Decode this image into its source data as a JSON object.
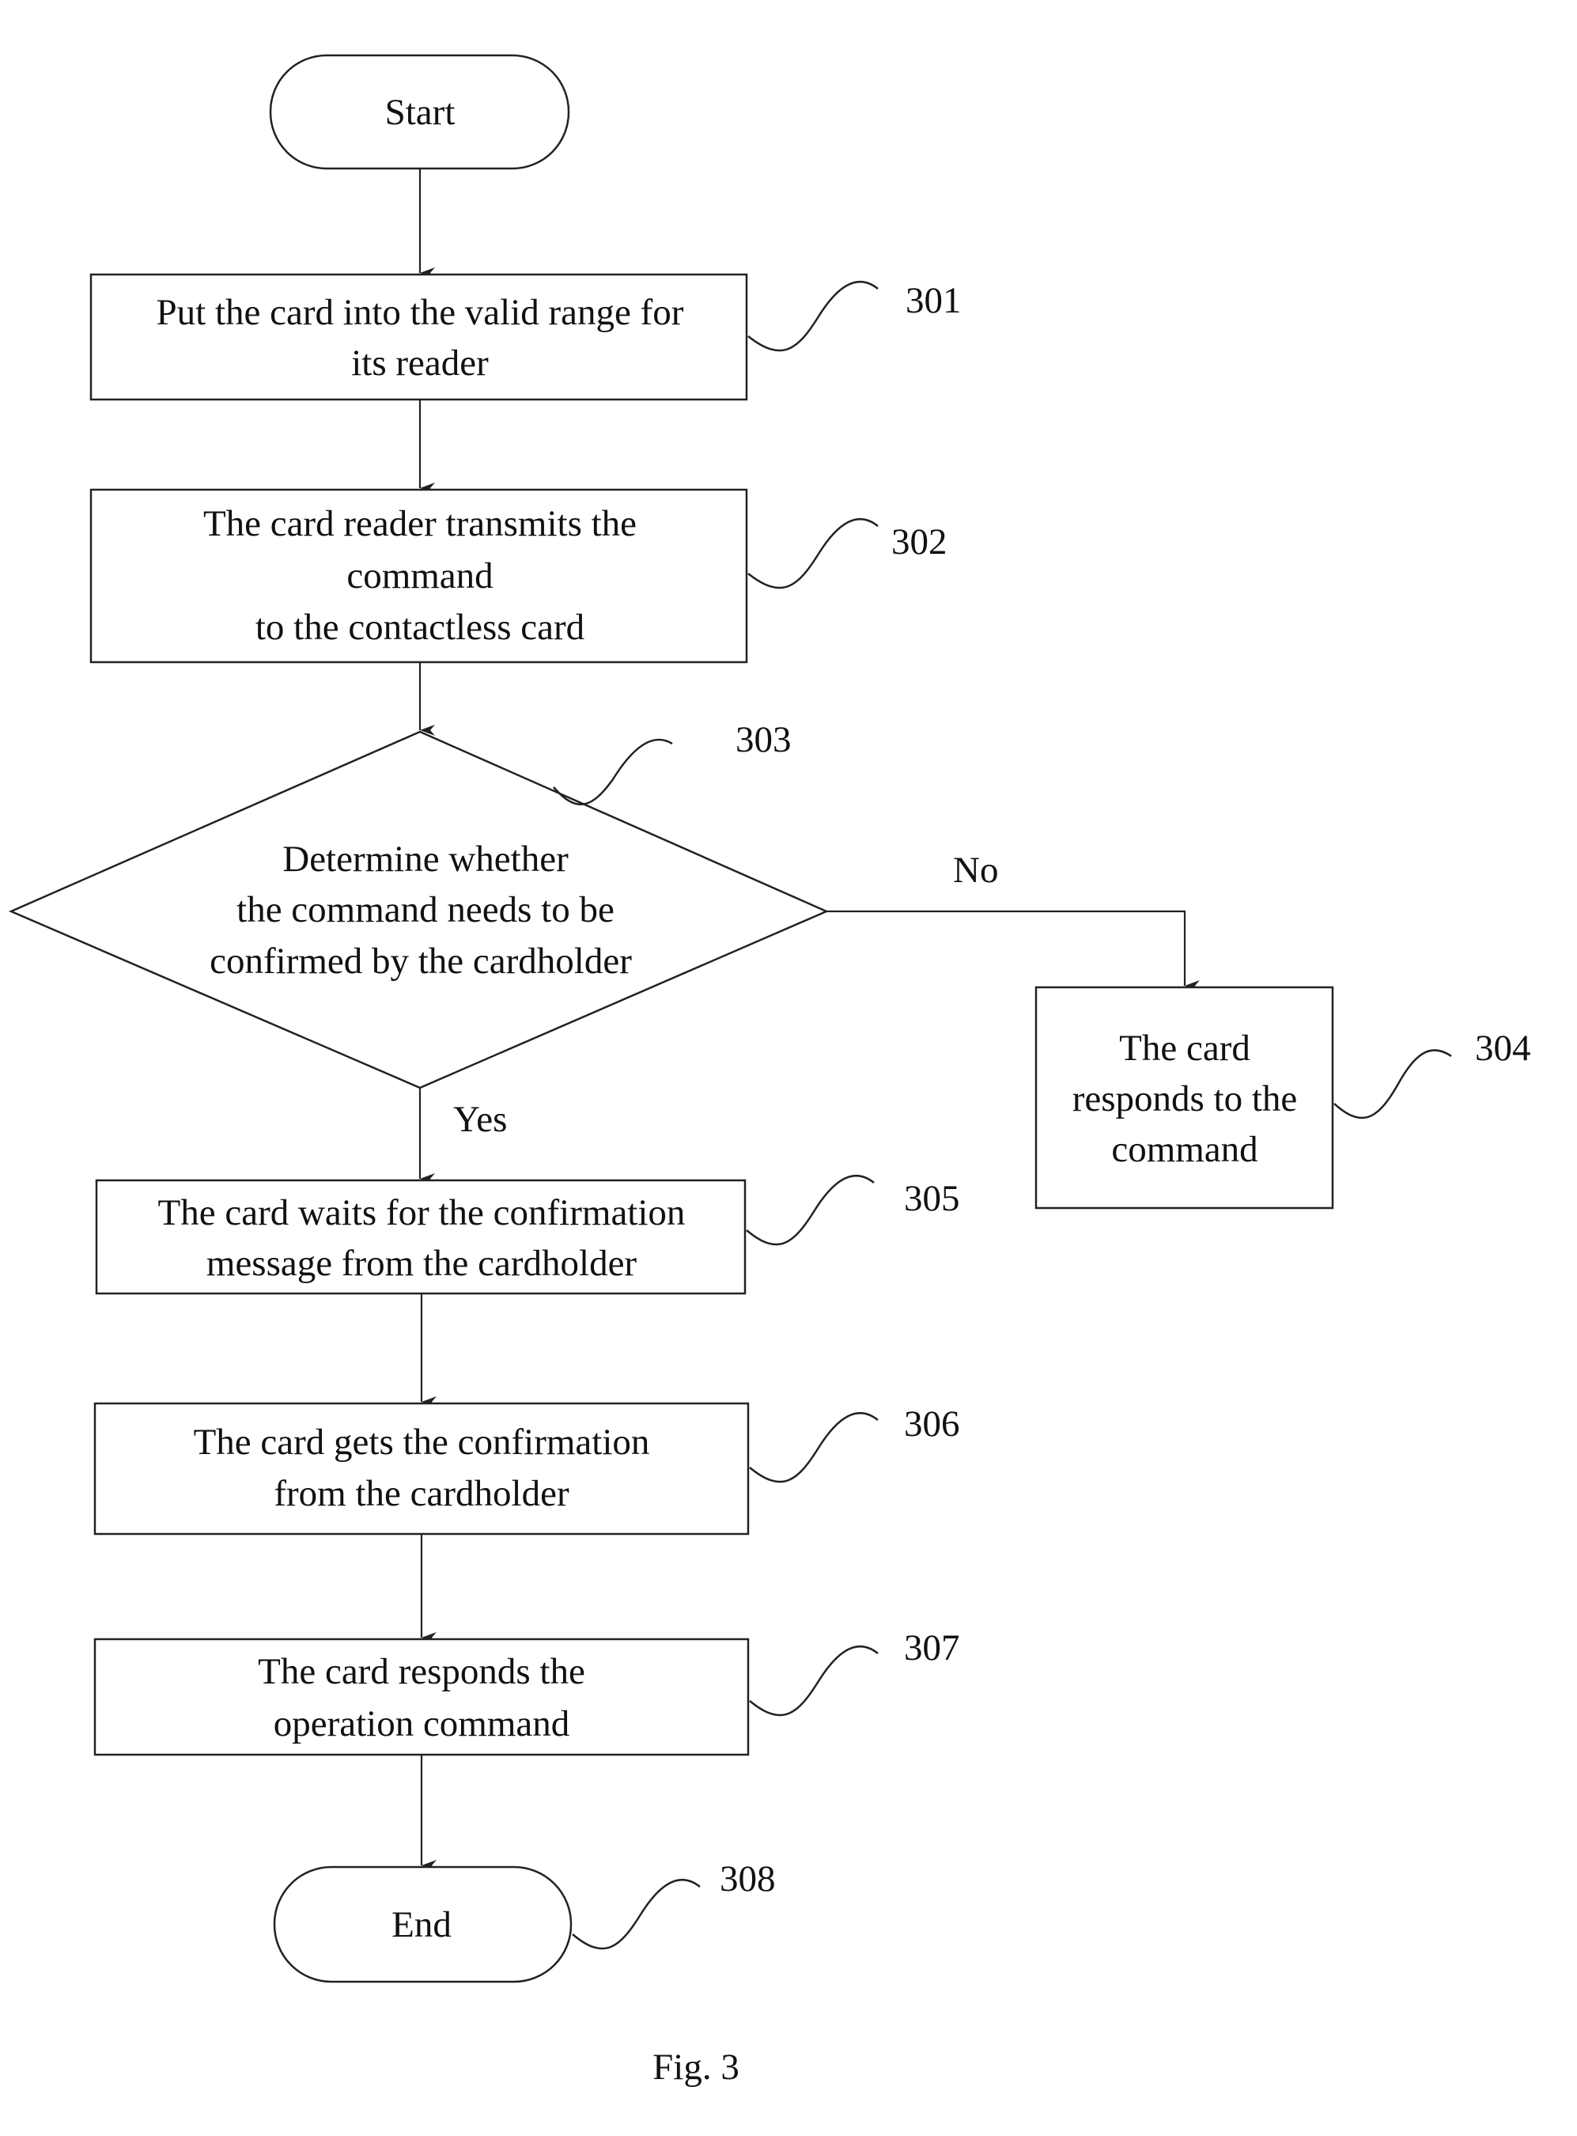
{
  "figure": {
    "caption": "Fig. 3",
    "nodes": {
      "start": {
        "type": "terminal",
        "lines": [
          "Start"
        ]
      },
      "s301": {
        "type": "process",
        "ref": "301",
        "lines": [
          "Put the card into the valid range for",
          "its reader"
        ]
      },
      "s302": {
        "type": "process",
        "ref": "302",
        "lines": [
          "The card reader transmits the",
          "command",
          "to  the contactless  card"
        ]
      },
      "s303": {
        "type": "decision",
        "ref": "303",
        "lines": [
          "Determine whether",
          "the command needs to be",
          "confirmed by  the cardholder"
        ]
      },
      "s304": {
        "type": "process",
        "ref": "304",
        "lines": [
          "The card",
          "responds to the",
          "command"
        ]
      },
      "s305": {
        "type": "process",
        "ref": "305",
        "lines": [
          "The card waits for the confirmation",
          "message  from the cardholder"
        ]
      },
      "s306": {
        "type": "process",
        "ref": "306",
        "lines": [
          "The card gets  the confirmation",
          "from the cardholder"
        ]
      },
      "s307": {
        "type": "process",
        "ref": "307",
        "lines": [
          "The card responds the",
          "operation command"
        ]
      },
      "end": {
        "type": "terminal",
        "ref": "308",
        "lines": [
          "End"
        ]
      }
    },
    "edges": [
      {
        "from": "start",
        "to": "s301",
        "label": ""
      },
      {
        "from": "s301",
        "to": "s302",
        "label": ""
      },
      {
        "from": "s302",
        "to": "s303",
        "label": ""
      },
      {
        "from": "s303",
        "to": "s304",
        "label": "No"
      },
      {
        "from": "s303",
        "to": "s305",
        "label": "Yes"
      },
      {
        "from": "s305",
        "to": "s306",
        "label": ""
      },
      {
        "from": "s306",
        "to": "s307",
        "label": ""
      },
      {
        "from": "s307",
        "to": "end",
        "label": ""
      }
    ]
  }
}
